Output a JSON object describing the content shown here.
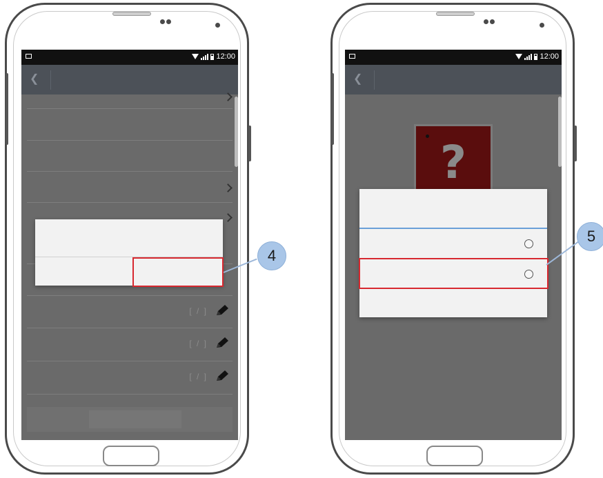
{
  "left_phone": {
    "status_bar": {
      "time": "12:00"
    },
    "list": {
      "row_tag": "[ / ]"
    },
    "callout": {
      "number": "4"
    }
  },
  "right_phone": {
    "status_bar": {
      "time": "12:00"
    },
    "card": {
      "symbol": "?"
    },
    "callout": {
      "number": "5"
    }
  },
  "colors": {
    "highlight": "#d7282f",
    "callout_badge": "#a9c6e8",
    "app_bar": "#4c5158",
    "dialog_divider": "#6a9fd8"
  },
  "icons": [
    "back-icon",
    "chevron-right-icon",
    "pencil-icon",
    "wifi-icon",
    "signal-icon",
    "battery-icon",
    "gallery-icon",
    "radio-button-icon"
  ]
}
